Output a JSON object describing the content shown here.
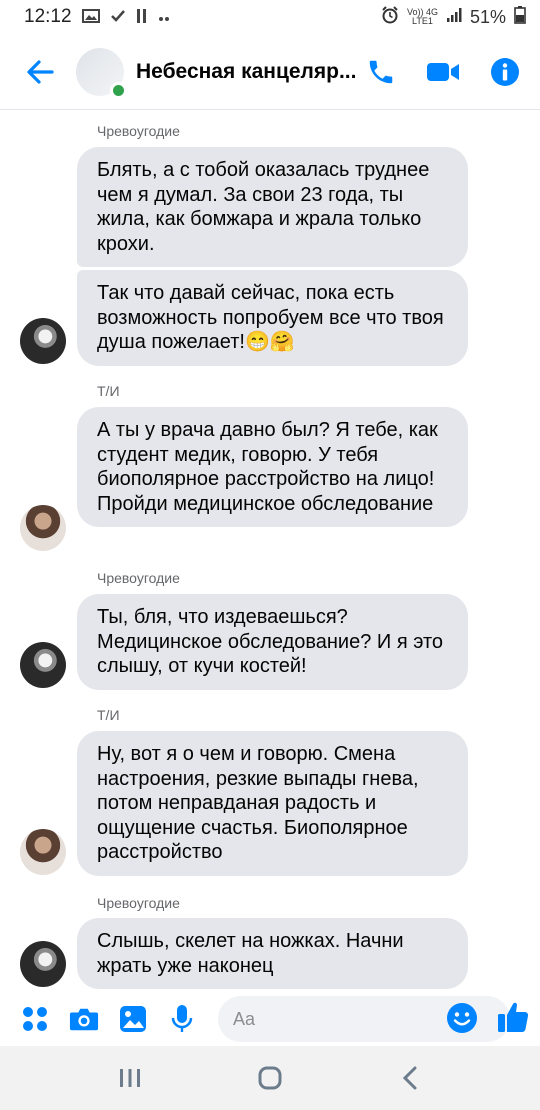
{
  "status_bar": {
    "time": "12:12",
    "battery": "51%",
    "network_top": "Vo)) 4G",
    "network_bottom": "LTE1"
  },
  "header": {
    "title": "Небесная канцеляр...",
    "icons": [
      "back-arrow-icon",
      "phone-icon",
      "video-camera-icon",
      "info-icon"
    ],
    "accent_color": "#0084ff"
  },
  "messages": [
    {
      "sender": "Чревоугодие",
      "texts": [
        "Блять, а с тобой оказалась труднее чем я думал. За свои 23 года, ты жила, как бомжара и жрала только крохи.",
        "Так что давай сейчас, пока есть возможность попробуем все что твоя душа пожелает!"
      ],
      "emojis": [
        "😁",
        "🤗"
      ]
    },
    {
      "sender": "Т/И",
      "texts": [
        "А ты у врача давно был? Я тебе, как студент медик, говорю. У тебя биополярное расстройство на лицо! Пройди медицинское обследование"
      ]
    },
    {
      "sender": "Чревоугодие",
      "texts": [
        "Ты, бля, что издеваешься? Медицинское обследование? И я это слышу, от кучи костей!"
      ]
    },
    {
      "sender": "Т/И",
      "texts": [
        "Ну, вот я о чем и говорю. Смена настроения, резкие выпады гнева, потом неправданая радость и ощущение счастья. Биополярное расстройство"
      ]
    },
    {
      "sender": "Чревоугодие",
      "texts": [
        "Слышь, скелет на ножках. Начни жрать уже наконец"
      ]
    }
  ],
  "composer": {
    "placeholder": "Aa",
    "icons": [
      "menu-dots-icon",
      "camera-icon",
      "gallery-icon",
      "microphone-icon",
      "emoji-icon",
      "thumbs-up-icon"
    ]
  },
  "navbar": {
    "icons": [
      "recent-apps-icon",
      "home-icon",
      "back-icon"
    ]
  }
}
